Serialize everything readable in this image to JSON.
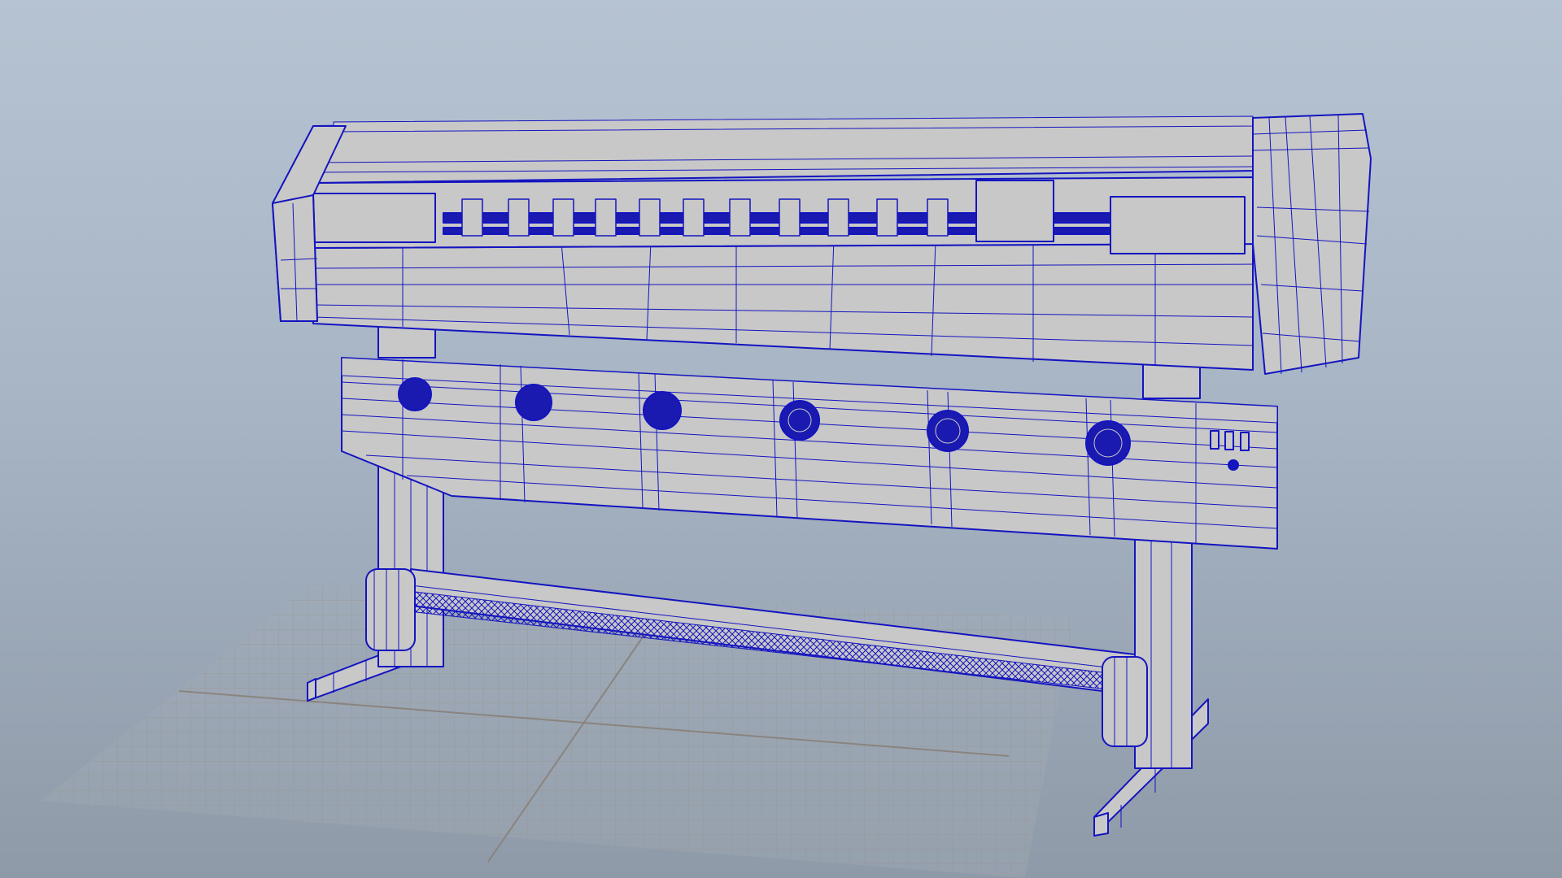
{
  "viewport": {
    "label": "",
    "background_top": "#b6c3d2",
    "background_bottom": "#8f9aa8"
  },
  "ground_grid": {
    "visible": true,
    "color": "#9a9590",
    "major_color": "#8a847e"
  },
  "model": {
    "display_mode": "wireframe-on-shaded",
    "wire_color": "#1414c0",
    "surface_color": "#c8c8c8",
    "panel_buttons": 3,
    "front_fans": 6
  }
}
